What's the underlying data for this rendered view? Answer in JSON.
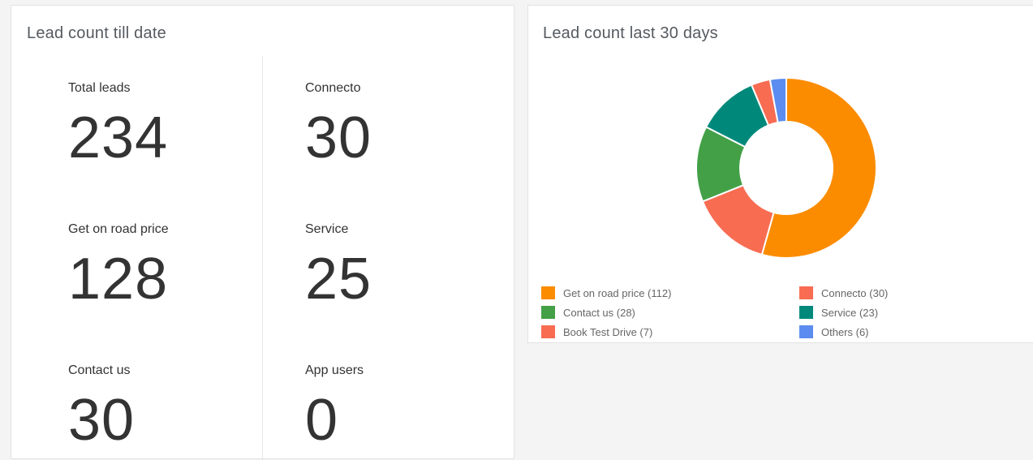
{
  "left_card": {
    "title": "Lead count till date",
    "stats": [
      {
        "label": "Total leads",
        "value": "234"
      },
      {
        "label": "Connecto",
        "value": "30"
      },
      {
        "label": "Get on road price",
        "value": "128"
      },
      {
        "label": "Service",
        "value": "25"
      },
      {
        "label": "Contact us",
        "value": "30"
      },
      {
        "label": "App users",
        "value": "0"
      }
    ]
  },
  "right_card": {
    "title": "Lead count last 30 days",
    "legend": [
      {
        "label": "Get on road price (112)",
        "color": "#fb8c00"
      },
      {
        "label": "Connecto (30)",
        "color": "#f86c52"
      },
      {
        "label": "Contact us (28)",
        "color": "#43a047"
      },
      {
        "label": "Service (23)",
        "color": "#00897b"
      },
      {
        "label": "Book Test Drive (7)",
        "color": "#f86c52"
      },
      {
        "label": "Others (6)",
        "color": "#5c8cef"
      }
    ]
  },
  "chart_data": {
    "type": "pie",
    "categories": [
      "Get on road price",
      "Connecto",
      "Contact us",
      "Service",
      "Book Test Drive",
      "Others"
    ],
    "values": [
      112,
      30,
      28,
      23,
      7,
      6
    ],
    "colors": [
      "#fb8c00",
      "#f86c52",
      "#43a047",
      "#00897b",
      "#f86c52",
      "#5c8cef"
    ],
    "title": "Lead count last 30 days",
    "donut": true,
    "legend": "bottom"
  }
}
